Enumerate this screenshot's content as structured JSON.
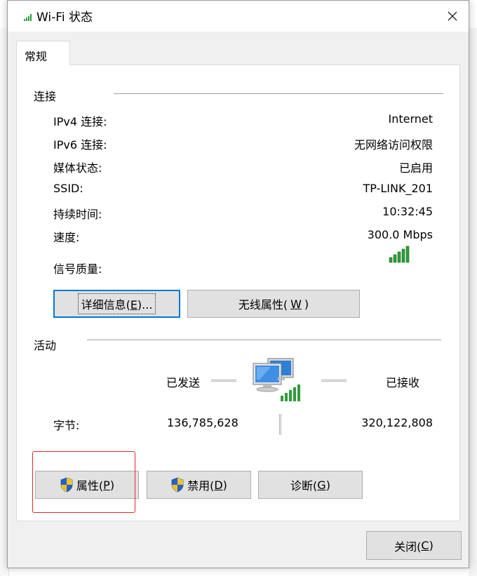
{
  "window": {
    "title": "Wi-Fi 状态",
    "title_icon": "wifi-signal-icon",
    "close_icon": "close-icon"
  },
  "tabs": [
    {
      "label": "常规",
      "active": true
    }
  ],
  "connection": {
    "heading": "连接",
    "rows": [
      {
        "label": "IPv4 连接:",
        "value": "Internet"
      },
      {
        "label": "IPv6 连接:",
        "value": "无网络访问权限"
      },
      {
        "label": "媒体状态:",
        "value": "已启用"
      },
      {
        "label": "SSID:",
        "value": "TP-LINK_201"
      },
      {
        "label": "持续时间:",
        "value": "10:32:45"
      },
      {
        "label": "速度:",
        "value": "300.0 Mbps"
      }
    ],
    "signal_label": "信号质量:",
    "signal_icon": "signal-strength-icon",
    "signal_bars_filled": 5,
    "signal_bars_total": 5
  },
  "buttons": {
    "details": {
      "text": "详细信息(",
      "key": "E",
      "suffix": ")..."
    },
    "wireless": {
      "text": "无线属性(",
      "key": "W",
      "suffix": ")"
    },
    "properties": {
      "text": "属性(",
      "key": "P",
      "suffix": ")",
      "icon": "uac-shield-icon"
    },
    "disable": {
      "text": "禁用(",
      "key": "D",
      "suffix": ")",
      "icon": "uac-shield-icon"
    },
    "diagnose": {
      "text": "诊断(",
      "key": "G",
      "suffix": ")"
    },
    "close": {
      "text": "关闭(",
      "key": "C",
      "suffix": ")"
    }
  },
  "activity": {
    "heading": "活动",
    "sent_label": "已发送",
    "received_label": "已接收",
    "bytes_label": "字节:",
    "bytes_sent": "136,785,628",
    "bytes_received": "320,122,808",
    "network_icon": "network-computers-icon"
  },
  "colors": {
    "focus_border": "#0078d7",
    "annotation_box": "#e8262a",
    "signal_green": "#2e9d3a",
    "shield_blue": "#1f63c6",
    "shield_yellow": "#f2c12e"
  }
}
